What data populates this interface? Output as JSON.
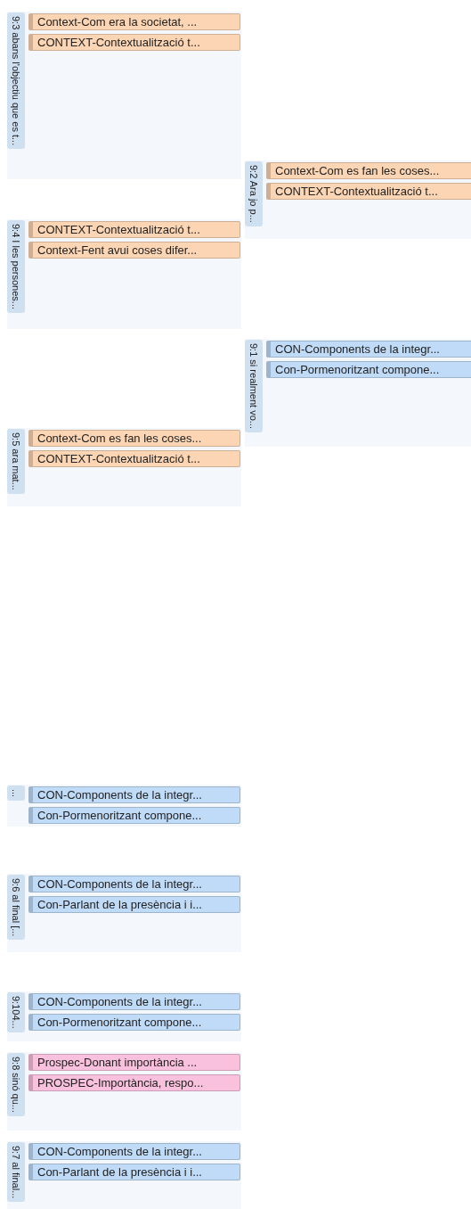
{
  "quotations": [
    {
      "label": "9:3 abans l'objectiu que es t...",
      "codes": [
        {
          "text": "Context-Com era la societat, ...",
          "color": "#fcd6b4"
        },
        {
          "text": "CONTEXT-Contextualització t...",
          "color": "#fcd6b4"
        }
      ]
    },
    {
      "label": "9:2 Ara jo p...",
      "codes": [
        {
          "text": "Context-Com es fan les coses...",
          "color": "#fcd6b4"
        },
        {
          "text": "CONTEXT-Contextualització t...",
          "color": "#fcd6b4"
        }
      ]
    },
    {
      "label": "9:4 I les persones...",
      "codes": [
        {
          "text": "CONTEXT-Contextualització t...",
          "color": "#fcd6b4"
        },
        {
          "text": "Context-Fent avui coses difer...",
          "color": "#fcd6b4"
        }
      ]
    },
    {
      "label": "9:1 si realment vo...",
      "codes": [
        {
          "text": "CON-Components de la integr...",
          "color": "#c0dbf7"
        },
        {
          "text": "Con-Pormenoritzant compone...",
          "color": "#c0dbf7"
        }
      ]
    },
    {
      "label": "9:5 ara mat...",
      "codes": [
        {
          "text": "Context-Com es fan les coses...",
          "color": "#fcd6b4"
        },
        {
          "text": "CONTEXT-Contextualització t...",
          "color": "#fcd6b4"
        }
      ]
    },
    {
      "label": "...",
      "codes": [
        {
          "text": "CON-Components de la integr...",
          "color": "#c0dbf7"
        },
        {
          "text": "Con-Pormenoritzant compone...",
          "color": "#c0dbf7"
        }
      ]
    },
    {
      "label": "9:6 al final [...",
      "codes": [
        {
          "text": "CON-Components de la integr...",
          "color": "#c0dbf7"
        },
        {
          "text": "Con-Parlant de la presència i i...",
          "color": "#c0dbf7"
        }
      ]
    },
    {
      "label": "9:104...",
      "codes": [
        {
          "text": "CON-Components de la integr...",
          "color": "#c0dbf7"
        },
        {
          "text": "Con-Pormenoritzant compone...",
          "color": "#c0dbf7"
        }
      ]
    },
    {
      "label": "9:8 sinó qu...",
      "codes": [
        {
          "text": "Prospec-Donant importància ...",
          "color": "#f9c1dd"
        },
        {
          "text": "PROSPEC-Importància, respo...",
          "color": "#f9c1dd"
        }
      ]
    },
    {
      "label": "9:7 al final...",
      "codes": [
        {
          "text": "CON-Components de la integr...",
          "color": "#c0dbf7"
        },
        {
          "text": "Con-Parlant de la presència i i...",
          "color": "#c0dbf7"
        }
      ]
    }
  ]
}
